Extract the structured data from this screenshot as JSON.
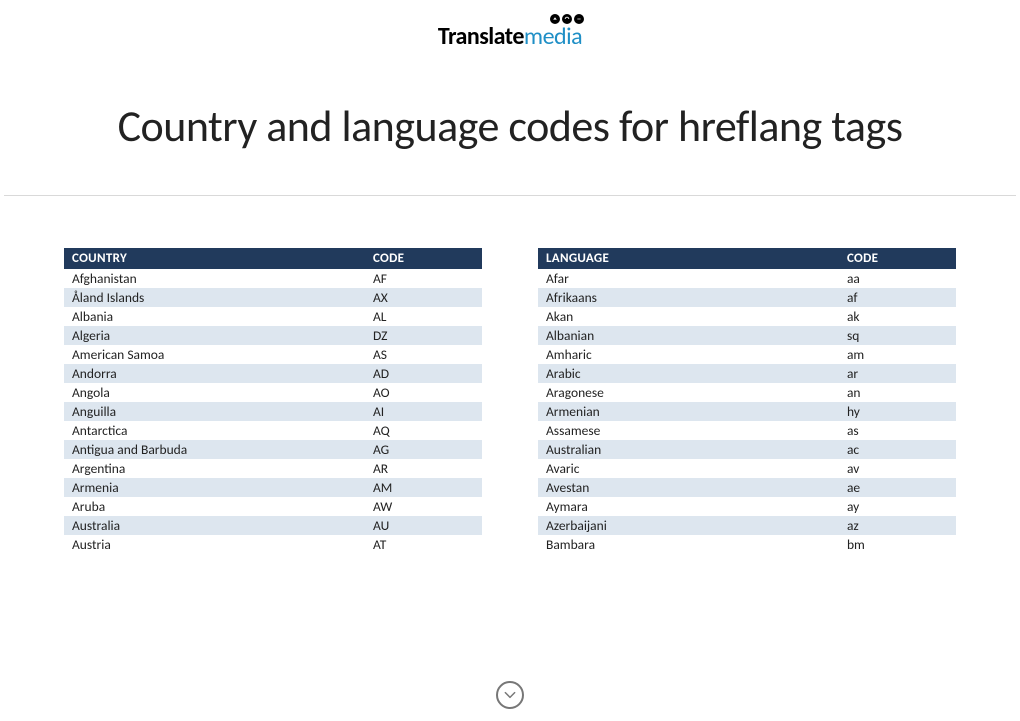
{
  "logo": {
    "part1": "Translate",
    "part2": "media"
  },
  "title": "Country and language codes for hreflang tags",
  "country_table": {
    "headers": {
      "col1": "COUNTRY",
      "col2": "CODE"
    },
    "rows": [
      {
        "name": "Afghanistan",
        "code": "AF"
      },
      {
        "name": "Åland Islands",
        "code": "AX"
      },
      {
        "name": "Albania",
        "code": "AL"
      },
      {
        "name": "Algeria",
        "code": "DZ"
      },
      {
        "name": "American Samoa",
        "code": "AS"
      },
      {
        "name": "Andorra",
        "code": "AD"
      },
      {
        "name": "Angola",
        "code": "AO"
      },
      {
        "name": "Anguilla",
        "code": "AI"
      },
      {
        "name": "Antarctica",
        "code": "AQ"
      },
      {
        "name": "Antigua and Barbuda",
        "code": "AG"
      },
      {
        "name": "Argentina",
        "code": "AR"
      },
      {
        "name": "Armenia",
        "code": "AM"
      },
      {
        "name": "Aruba",
        "code": "AW"
      },
      {
        "name": "Australia",
        "code": "AU"
      },
      {
        "name": "Austria",
        "code": "AT"
      }
    ]
  },
  "language_table": {
    "headers": {
      "col1": "LANGUAGE",
      "col2": "CODE"
    },
    "rows": [
      {
        "name": "Afar",
        "code": "aa"
      },
      {
        "name": "Afrikaans",
        "code": "af"
      },
      {
        "name": "Akan",
        "code": "ak"
      },
      {
        "name": "Albanian",
        "code": "sq"
      },
      {
        "name": "Amharic",
        "code": "am"
      },
      {
        "name": "Arabic",
        "code": "ar"
      },
      {
        "name": "Aragonese",
        "code": "an"
      },
      {
        "name": "Armenian",
        "code": "hy"
      },
      {
        "name": "Assamese",
        "code": "as"
      },
      {
        "name": "Australian",
        "code": "ac"
      },
      {
        "name": "Avaric",
        "code": "av"
      },
      {
        "name": "Avestan",
        "code": "ae"
      },
      {
        "name": "Aymara",
        "code": "ay"
      },
      {
        "name": "Azerbaijani",
        "code": "az"
      },
      {
        "name": "Bambara",
        "code": "bm"
      }
    ]
  }
}
